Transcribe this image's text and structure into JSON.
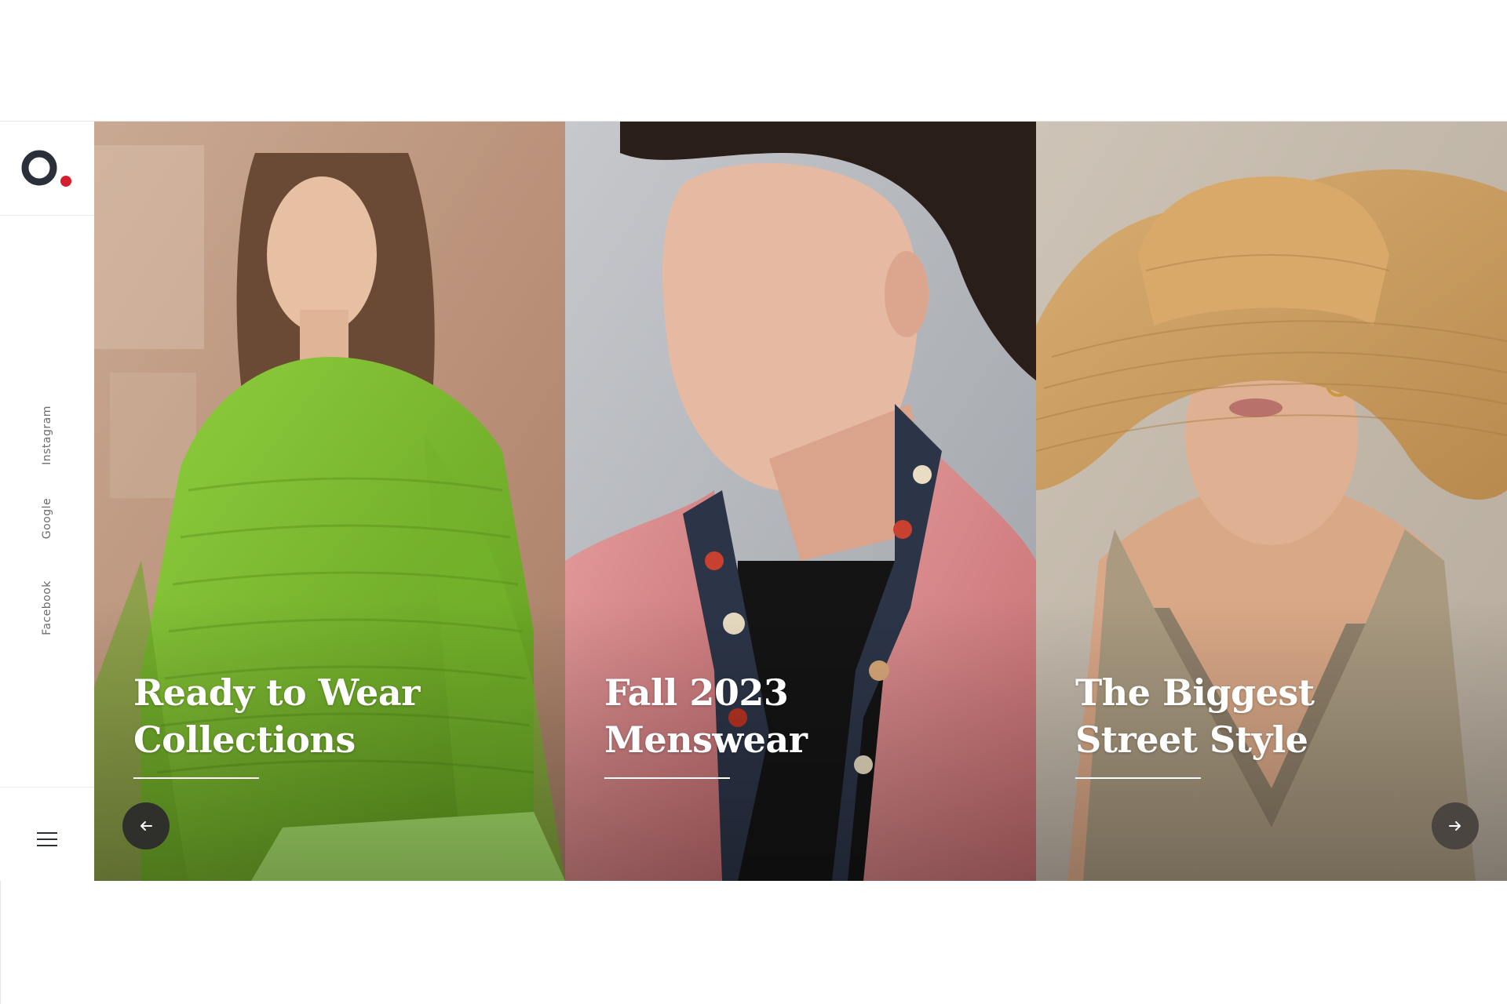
{
  "brand": {
    "logo_icon": "brand-logo-o",
    "primary_color": "#2b2f3a",
    "accent_color": "#d41f2c"
  },
  "sidebar": {
    "social_links": [
      {
        "label": "Instagram"
      },
      {
        "label": "Google"
      },
      {
        "label": "Facebook"
      }
    ],
    "menu_icon": "hamburger-icon"
  },
  "slides": [
    {
      "title": "Ready to Wear\nCollections",
      "theme": "green knit sweater"
    },
    {
      "title": "Fall 2023\nMenswear",
      "theme": "pink blazer"
    },
    {
      "title": "The Biggest\nStreet Style",
      "theme": "straw hat"
    }
  ],
  "slider_nav": {
    "prev_icon": "arrow-left-icon",
    "next_icon": "arrow-right-icon"
  }
}
